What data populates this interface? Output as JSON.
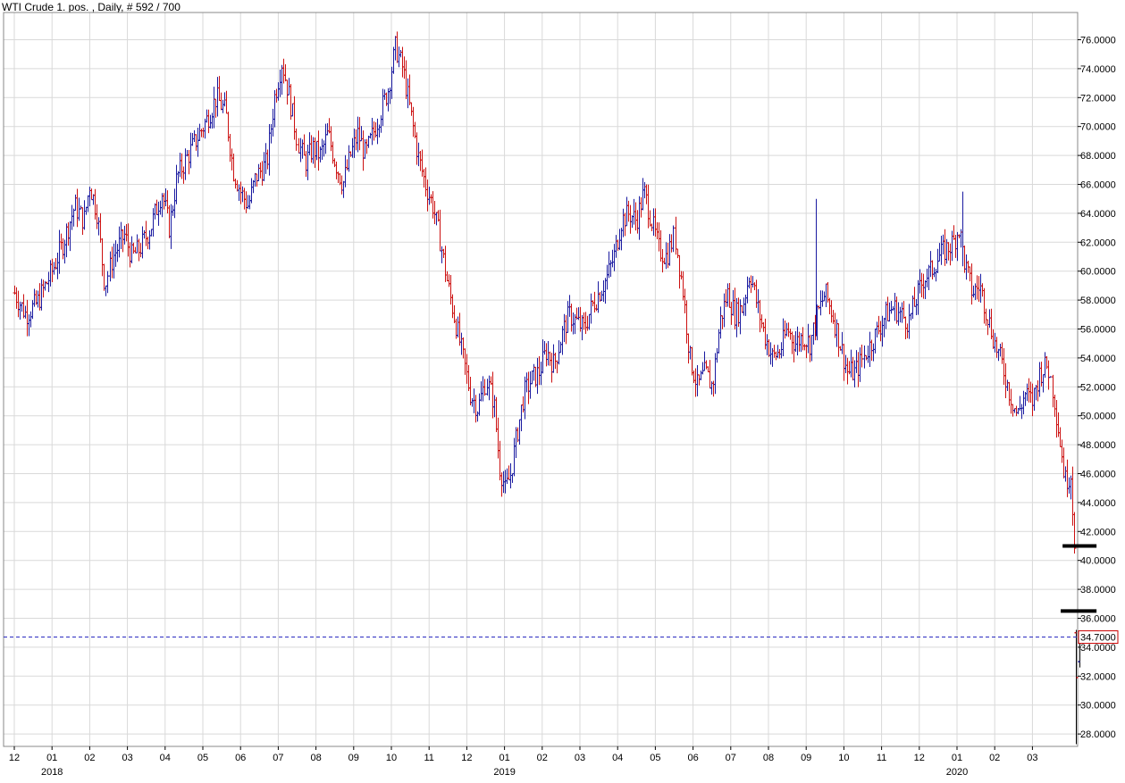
{
  "chart_title": "WTI Crude 1. pos. , Daily, # 592 / 700",
  "colors": {
    "up": "#1a1aa0",
    "down": "#cc1111",
    "grid": "#d9d9d9",
    "marker": "#000000",
    "last_line": "#2a2ac0",
    "last_box": "#cc0000"
  },
  "chart_data": {
    "type": "ohlc",
    "title": "WTI Crude 1. pos. , Daily, # 592 / 700",
    "ylim": [
      27,
      77.5
    ],
    "y_ticks": [
      "76.0000",
      "74.0000",
      "72.0000",
      "70.0000",
      "68.0000",
      "66.0000",
      "64.0000",
      "62.0000",
      "60.0000",
      "58.0000",
      "56.0000",
      "54.0000",
      "52.0000",
      "50.0000",
      "48.0000",
      "46.0000",
      "44.0000",
      "42.0000",
      "40.0000",
      "38.0000",
      "36.0000",
      "34.0000",
      "32.0000",
      "30.0000",
      "28.0000"
    ],
    "x_month_ticks": [
      "12",
      "01",
      "02",
      "03",
      "04",
      "05",
      "06",
      "07",
      "08",
      "09",
      "10",
      "11",
      "12",
      "01",
      "02",
      "03",
      "04",
      "05",
      "06",
      "07",
      "08",
      "09",
      "10",
      "11",
      "12",
      "01",
      "02",
      "03"
    ],
    "year_labels": [
      {
        "label": "2018",
        "month_index": 1
      },
      {
        "label": "2019",
        "month_index": 13
      },
      {
        "label": "2020",
        "month_index": 25
      }
    ],
    "close_path": [
      [
        0,
        58.5
      ],
      [
        0.3,
        57.0
      ],
      [
        0.6,
        57.8
      ],
      [
        1.0,
        60.0
      ],
      [
        1.3,
        62.0
      ],
      [
        1.6,
        64.5
      ],
      [
        1.85,
        63.5
      ],
      [
        2.0,
        66.0
      ],
      [
        2.2,
        64.0
      ],
      [
        2.4,
        59.0
      ],
      [
        2.6,
        61.0
      ],
      [
        2.9,
        62.5
      ],
      [
        3.1,
        61.0
      ],
      [
        3.3,
        61.5
      ],
      [
        3.6,
        63.0
      ],
      [
        3.9,
        65.5
      ],
      [
        4.1,
        63.0
      ],
      [
        4.3,
        66.5
      ],
      [
        4.6,
        68.0
      ],
      [
        4.9,
        69.5
      ],
      [
        5.1,
        70.5
      ],
      [
        5.35,
        72.0
      ],
      [
        5.6,
        71.0
      ],
      [
        5.8,
        67.0
      ],
      [
        6.0,
        65.5
      ],
      [
        6.2,
        64.5
      ],
      [
        6.4,
        66.5
      ],
      [
        6.7,
        67.5
      ],
      [
        6.9,
        72.0
      ],
      [
        7.1,
        74.5
      ],
      [
        7.3,
        72.0
      ],
      [
        7.5,
        69.0
      ],
      [
        7.7,
        67.5
      ],
      [
        7.9,
        68.5
      ],
      [
        8.1,
        68.0
      ],
      [
        8.3,
        69.5
      ],
      [
        8.5,
        67.5
      ],
      [
        8.7,
        66.0
      ],
      [
        8.9,
        68.0
      ],
      [
        9.1,
        69.5
      ],
      [
        9.3,
        68.0
      ],
      [
        9.5,
        69.5
      ],
      [
        9.7,
        71.0
      ],
      [
        9.9,
        72.5
      ],
      [
        10.1,
        75.5
      ],
      [
        10.3,
        74.0
      ],
      [
        10.5,
        71.0
      ],
      [
        10.7,
        68.0
      ],
      [
        10.9,
        66.0
      ],
      [
        11.1,
        64.5
      ],
      [
        11.3,
        62.0
      ],
      [
        11.5,
        59.0
      ],
      [
        11.7,
        56.5
      ],
      [
        11.9,
        54.0
      ],
      [
        12.1,
        51.5
      ],
      [
        12.3,
        50.5
      ],
      [
        12.5,
        52.5
      ],
      [
        12.7,
        51.0
      ],
      [
        12.85,
        46.5
      ],
      [
        12.95,
        45.5
      ],
      [
        13.0,
        44.8
      ],
      [
        13.15,
        46.0
      ],
      [
        13.3,
        48.5
      ],
      [
        13.5,
        51.5
      ],
      [
        13.7,
        52.5
      ],
      [
        13.9,
        53.0
      ],
      [
        14.1,
        54.5
      ],
      [
        14.3,
        53.5
      ],
      [
        14.5,
        55.5
      ],
      [
        14.7,
        57.0
      ],
      [
        14.9,
        56.5
      ],
      [
        15.1,
        56.0
      ],
      [
        15.3,
        57.5
      ],
      [
        15.5,
        58.5
      ],
      [
        15.7,
        59.5
      ],
      [
        15.9,
        61.0
      ],
      [
        16.1,
        63.5
      ],
      [
        16.3,
        64.0
      ],
      [
        16.5,
        63.5
      ],
      [
        16.7,
        65.5
      ],
      [
        16.9,
        63.5
      ],
      [
        17.1,
        61.5
      ],
      [
        17.3,
        61.0
      ],
      [
        17.5,
        62.5
      ],
      [
        17.7,
        59.0
      ],
      [
        17.9,
        54.0
      ],
      [
        18.1,
        52.0
      ],
      [
        18.3,
        53.0
      ],
      [
        18.5,
        52.0
      ],
      [
        18.7,
        56.5
      ],
      [
        18.9,
        58.5
      ],
      [
        19.1,
        57.0
      ],
      [
        19.3,
        57.5
      ],
      [
        19.5,
        60.0
      ],
      [
        19.7,
        57.5
      ],
      [
        19.9,
        55.5
      ],
      [
        20.1,
        54.0
      ],
      [
        20.3,
        54.5
      ],
      [
        20.5,
        56.0
      ],
      [
        20.7,
        55.0
      ],
      [
        20.9,
        55.5
      ],
      [
        21.1,
        55.0
      ],
      [
        21.3,
        57.0
      ],
      [
        21.5,
        58.5
      ],
      [
        21.7,
        57.0
      ],
      [
        21.9,
        55.0
      ],
      [
        22.1,
        53.0
      ],
      [
        22.3,
        53.0
      ],
      [
        22.5,
        54.0
      ],
      [
        22.7,
        55.0
      ],
      [
        22.9,
        56.0
      ],
      [
        23.1,
        57.0
      ],
      [
        23.3,
        57.5
      ],
      [
        23.5,
        57.0
      ],
      [
        23.7,
        56.5
      ],
      [
        23.9,
        58.0
      ],
      [
        24.1,
        59.5
      ],
      [
        24.3,
        60.0
      ],
      [
        24.5,
        61.0
      ],
      [
        24.7,
        61.5
      ],
      [
        24.9,
        62.0
      ],
      [
        25.05,
        63.0
      ],
      [
        25.2,
        60.5
      ],
      [
        25.4,
        58.5
      ],
      [
        25.6,
        59.0
      ],
      [
        25.8,
        57.0
      ],
      [
        26.0,
        55.0
      ],
      [
        26.2,
        53.5
      ],
      [
        26.4,
        51.5
      ],
      [
        26.6,
        50.0
      ],
      [
        26.8,
        51.5
      ],
      [
        27.0,
        51.0
      ],
      [
        27.2,
        53.0
      ],
      [
        27.4,
        53.5
      ],
      [
        27.55,
        51.5
      ],
      [
        27.7,
        48.5
      ],
      [
        27.85,
        45.5
      ],
      [
        28.0,
        46.0
      ],
      [
        28.1,
        41.2
      ]
    ],
    "big_drop_bars": [
      {
        "month": 28.15,
        "open": 35.0,
        "high": 35.2,
        "low": 27.3,
        "close": 31.9
      },
      {
        "month": 28.25,
        "open": 33.0,
        "high": 34.9,
        "low": 32.6,
        "close": 34.7
      }
    ],
    "last_price_label": "34.7000",
    "last_price": 34.7,
    "horizontal_marks": [
      {
        "from_month": 27.8,
        "to_month": 28.7,
        "value": 41.0
      },
      {
        "from_month": 27.75,
        "to_month": 28.7,
        "value": 36.5
      }
    ],
    "notable_spikes": [
      {
        "month": 21.25,
        "high": 65.0
      },
      {
        "month": 25.15,
        "high": 65.5
      }
    ],
    "grid": true
  }
}
